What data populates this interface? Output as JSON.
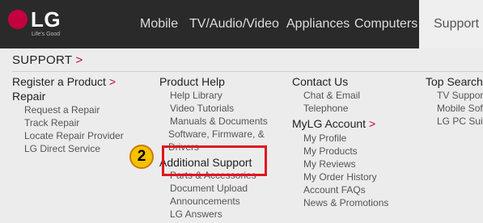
{
  "brand": {
    "name": "LG",
    "tagline": "Life's Good"
  },
  "nav": [
    "Mobile",
    "TV/Audio/Video",
    "Appliances",
    "Computers",
    "Support"
  ],
  "menu": {
    "title": "SUPPORT",
    "arrow": ">",
    "col1": {
      "register": "Register a Product",
      "repair": "Repair",
      "items": [
        "Request a Repair",
        "Track Repair",
        "Locate Repair Provider",
        "LG Direct Service"
      ]
    },
    "col2": {
      "product_help": "Product Help",
      "items": [
        "Help Library",
        "Video Tutorials",
        "Manuals & Documents",
        "Software, Firmware, &",
        "Drivers"
      ],
      "additional": "Additional Support",
      "additional_items": [
        "Parts & Accessories",
        "Document Upload",
        "Announcements",
        "LG Answers"
      ]
    },
    "col3": {
      "contact": "Contact Us",
      "contact_items": [
        "Chat & Email",
        "Telephone"
      ],
      "mylg": "MyLG Account",
      "mylg_items": [
        "My Profile",
        "My Products",
        "My Reviews",
        "My Order History",
        "Account FAQs",
        "News & Promotions"
      ]
    },
    "col4": {
      "top_searches": "Top Searches",
      "items": [
        "TV Support C",
        "Mobile Softw",
        "LG PC Suite"
      ]
    }
  },
  "annotation": {
    "step": "2"
  },
  "colors": {
    "brand": "#c4003e",
    "highlight": "#e0161e",
    "badge": "#f5c200"
  }
}
